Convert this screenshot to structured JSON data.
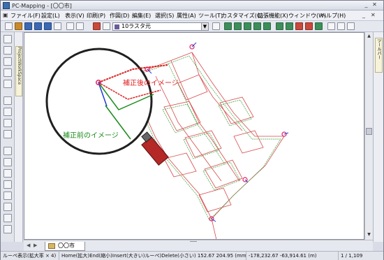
{
  "window": {
    "title": "PC-Mapping - [〇〇市]"
  },
  "menu": {
    "items": [
      "ファイル(F)",
      "設定(L)",
      "表示(V)",
      "印刷(P)",
      "作図(D)",
      "編集(E)",
      "選択(S)",
      "属性(A)",
      "ツール(T)",
      "カスタマイズ(C)",
      "拡張機能(X)",
      "ウィンドウ(W)",
      "ヘルプ(H)"
    ]
  },
  "toolbar": {
    "layer_value": "10ラスタ元"
  },
  "panels": {
    "left_tab": "ProjectWorkSpace",
    "right_tab": "ツールバー"
  },
  "canvas": {
    "annotation_after": "補正後のイメージ",
    "annotation_before": "補正前のイメージ",
    "colors": {
      "after": "#e02020",
      "before": "#1a8a1a",
      "parcel_red": "#d74a4a",
      "parcel_green": "#3aa03a",
      "control_point": "#e0206a",
      "vector": "#1f3bd6"
    }
  },
  "tabs": {
    "document": "〇〇市"
  },
  "status": {
    "mode": "ルーペ表示(拡大率 × 4)",
    "hint": "Home(拡大)End(縮小)Insert(大きい)ルーペ)Delete(小さい) 152.67 204.95 (mm)",
    "coords": "-178,232.67 -63,914.61 (m)",
    "page": "1 / 1,109"
  }
}
